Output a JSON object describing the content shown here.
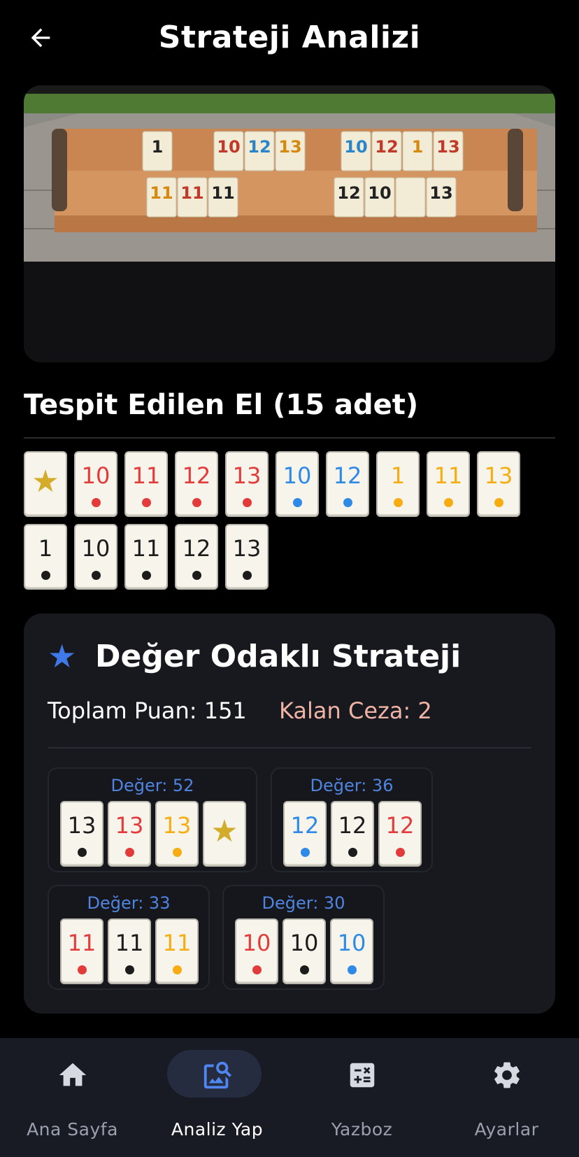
{
  "header": {
    "title": "Strateji Analizi"
  },
  "colors": {
    "red": "#e33a3a",
    "blue": "#2e8ae6",
    "yellow": "#f5ad12",
    "black": "#1c1c1c",
    "joker": "#d4ac2b",
    "accent": "#3f78e8"
  },
  "hand": {
    "title": "Tespit Edilen El (15 adet)",
    "tiles": [
      {
        "joker": true
      },
      {
        "num": "10",
        "color": "red"
      },
      {
        "num": "11",
        "color": "red"
      },
      {
        "num": "12",
        "color": "red"
      },
      {
        "num": "13",
        "color": "red"
      },
      {
        "num": "10",
        "color": "blue"
      },
      {
        "num": "12",
        "color": "blue"
      },
      {
        "num": "1",
        "color": "yellow"
      },
      {
        "num": "11",
        "color": "yellow"
      },
      {
        "num": "13",
        "color": "yellow"
      },
      {
        "num": "1",
        "color": "black"
      },
      {
        "num": "10",
        "color": "black"
      },
      {
        "num": "11",
        "color": "black"
      },
      {
        "num": "12",
        "color": "black"
      },
      {
        "num": "13",
        "color": "black"
      }
    ]
  },
  "strategy": {
    "icon": "star-icon",
    "title": "Değer Odaklı Strateji",
    "total": "Toplam Puan: 151",
    "penalty": "Kalan Ceza: 2",
    "groups": [
      {
        "label": "Değer: 52",
        "tiles": [
          {
            "num": "13",
            "color": "black"
          },
          {
            "num": "13",
            "color": "red"
          },
          {
            "num": "13",
            "color": "yellow"
          },
          {
            "joker": true
          }
        ]
      },
      {
        "label": "Değer: 36",
        "tiles": [
          {
            "num": "12",
            "color": "blue"
          },
          {
            "num": "12",
            "color": "black"
          },
          {
            "num": "12",
            "color": "red"
          }
        ]
      },
      {
        "label": "Değer: 33",
        "tiles": [
          {
            "num": "11",
            "color": "red"
          },
          {
            "num": "11",
            "color": "black"
          },
          {
            "num": "11",
            "color": "yellow"
          }
        ]
      },
      {
        "label": "Değer: 30",
        "tiles": [
          {
            "num": "10",
            "color": "red"
          },
          {
            "num": "10",
            "color": "black"
          },
          {
            "num": "10",
            "color": "blue"
          }
        ]
      }
    ]
  },
  "nav": {
    "items": [
      {
        "label": "Ana Sayfa",
        "icon": "home-icon"
      },
      {
        "label": "Analiz Yap",
        "icon": "image-search-icon",
        "active": true
      },
      {
        "label": "Yazboz",
        "icon": "calculator-icon"
      },
      {
        "label": "Ayarlar",
        "icon": "gear-icon"
      }
    ]
  }
}
